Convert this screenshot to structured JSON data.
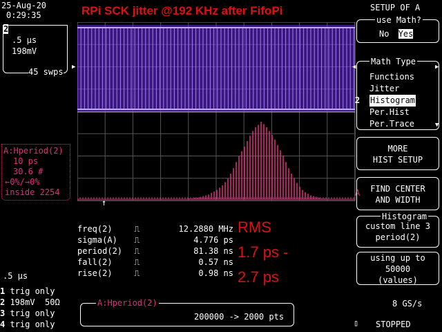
{
  "status": {
    "date": "25-Aug-20",
    "time": "0:29:35"
  },
  "trace": {
    "num": "2",
    "timebase": ".5 μs",
    "volts": "198mV",
    "sweeps": "45 swps"
  },
  "title": "RPi SCK jitter @192 KHz after FifoPi",
  "math_trace": {
    "title_label": "A:Hperiod(2)",
    "bin": "10 ps",
    "count": "30.6 #",
    "range": "←0%/→0%",
    "inside": "inside 2254"
  },
  "measurements": [
    {
      "label": "freq(2)",
      "value": "12.2880 MHz"
    },
    {
      "label": "sigma(A)",
      "value": "4.776 ps"
    },
    {
      "label": "period(2)",
      "value": "81.38 ns"
    },
    {
      "label": "fall(2)",
      "value": "0.57 ns"
    },
    {
      "label": "rise(2)",
      "value": "0.98 ns"
    }
  ],
  "annotation": {
    "line1": "RMS",
    "line2": "1.7 ps -",
    "line3": "2.7 ps"
  },
  "bottom_left": {
    "timebase": ".5 μs",
    "channels": [
      {
        "num": "1",
        "text": "trig only"
      },
      {
        "num": "2",
        "text": "198mV  50Ω"
      },
      {
        "num": "3",
        "text": "trig only"
      },
      {
        "num": "4",
        "text": "trig only"
      }
    ]
  },
  "bottom_box": {
    "label": "A:Hperiod(2)",
    "points": "200000 -> 2000 pts"
  },
  "panel": {
    "title": "SETUP OF A",
    "use_math": {
      "legend": "use Math?",
      "no": "No",
      "yes": "Yes"
    },
    "math_type": {
      "legend": "Math Type",
      "options": [
        "Functions",
        "Jitter",
        "Histogram",
        "Per.Hist",
        "Per.Trace"
      ],
      "selected": "Histogram"
    },
    "more_hist": {
      "line1": "MORE",
      "line2": "HIST SETUP"
    },
    "find_center": {
      "line1": "FIND CENTER",
      "line2": "AND WIDTH"
    },
    "histogram_box": {
      "legend": "Histogram",
      "line1": "custom line 3",
      "line2": "period(2)"
    },
    "using_box": {
      "line1": "using up to",
      "line2": "50000",
      "line3": "(values)"
    },
    "sample_rate": "8 GS/s",
    "state": "STOPPED"
  },
  "colors": {
    "magenta": "#e0307a",
    "red": "#e01010",
    "waveform": "#6a2be0",
    "grid": "#555555"
  },
  "histogram_data": [
    0,
    0,
    0,
    1,
    1,
    2,
    2,
    3,
    4,
    5,
    6,
    8,
    10,
    12,
    15,
    18,
    22,
    27,
    33,
    40,
    48,
    56,
    62,
    68,
    75,
    82,
    88,
    93,
    96,
    100,
    97,
    93,
    88,
    83,
    77,
    70,
    63,
    56,
    48,
    40,
    33,
    27,
    21,
    16,
    12,
    9,
    7,
    5,
    4,
    3,
    2,
    1,
    1,
    0,
    0
  ]
}
